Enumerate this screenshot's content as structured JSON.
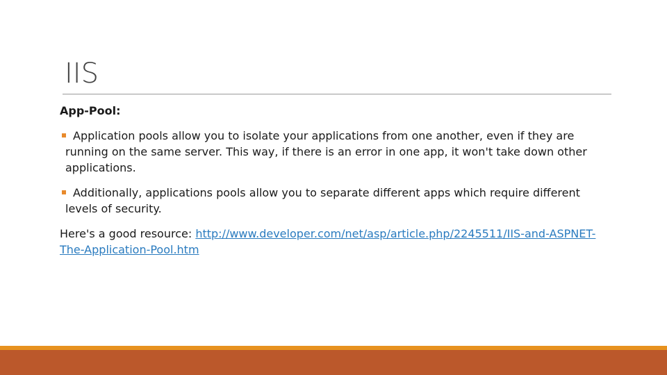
{
  "slide": {
    "title": "IIS",
    "subheading": "App-Pool:",
    "bullets": [
      "Application pools allow you to isolate your applications from one another, even if they are running on the same server. This way, if there is an error in one app, it won't take down other applications.",
      "Additionally, applications pools allow you to separate different apps which require different levels of security."
    ],
    "resource_prefix": "Here's a good resource: ",
    "resource_link": "http://www.developer.com/net/asp/article.php/2245511/IIS-and-ASPNET-The-Application-Pool.htm"
  },
  "colors": {
    "bullet": "#e88a2c",
    "link": "#2a7bbf",
    "footer_top": "#e7921f",
    "footer": "#bb582b",
    "rule": "#9a9a9a"
  }
}
